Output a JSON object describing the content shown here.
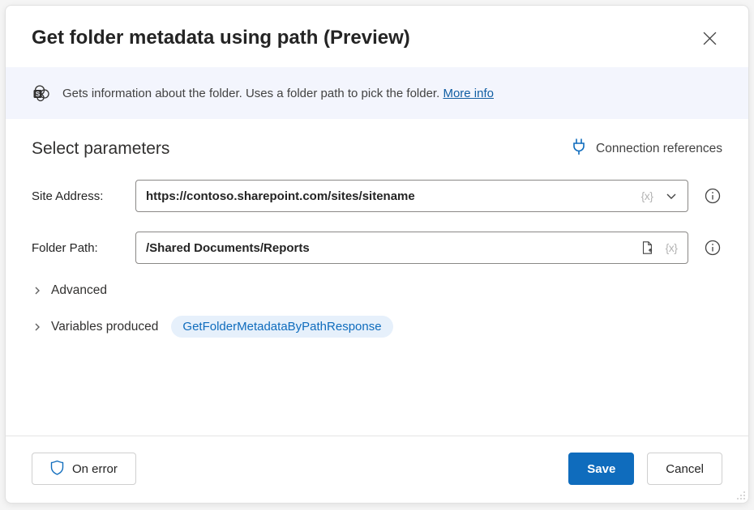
{
  "header": {
    "title": "Get folder metadata using path (Preview)"
  },
  "banner": {
    "text": "Gets information about the folder. Uses a folder path to pick the folder. ",
    "link_label": "More info"
  },
  "section": {
    "title": "Select parameters",
    "connection_label": "Connection references"
  },
  "fields": {
    "site": {
      "label": "Site Address:",
      "value": "https://contoso.sharepoint.com/sites/sitename",
      "fx": "{x}"
    },
    "folder": {
      "label": "Folder Path:",
      "value": "/Shared Documents/Reports",
      "fx": "{x}"
    }
  },
  "collapsibles": {
    "advanced_label": "Advanced",
    "variables_label": "Variables produced",
    "variable_pill": "GetFolderMetadataByPathResponse"
  },
  "footer": {
    "on_error_label": "On error",
    "save_label": "Save",
    "cancel_label": "Cancel"
  }
}
